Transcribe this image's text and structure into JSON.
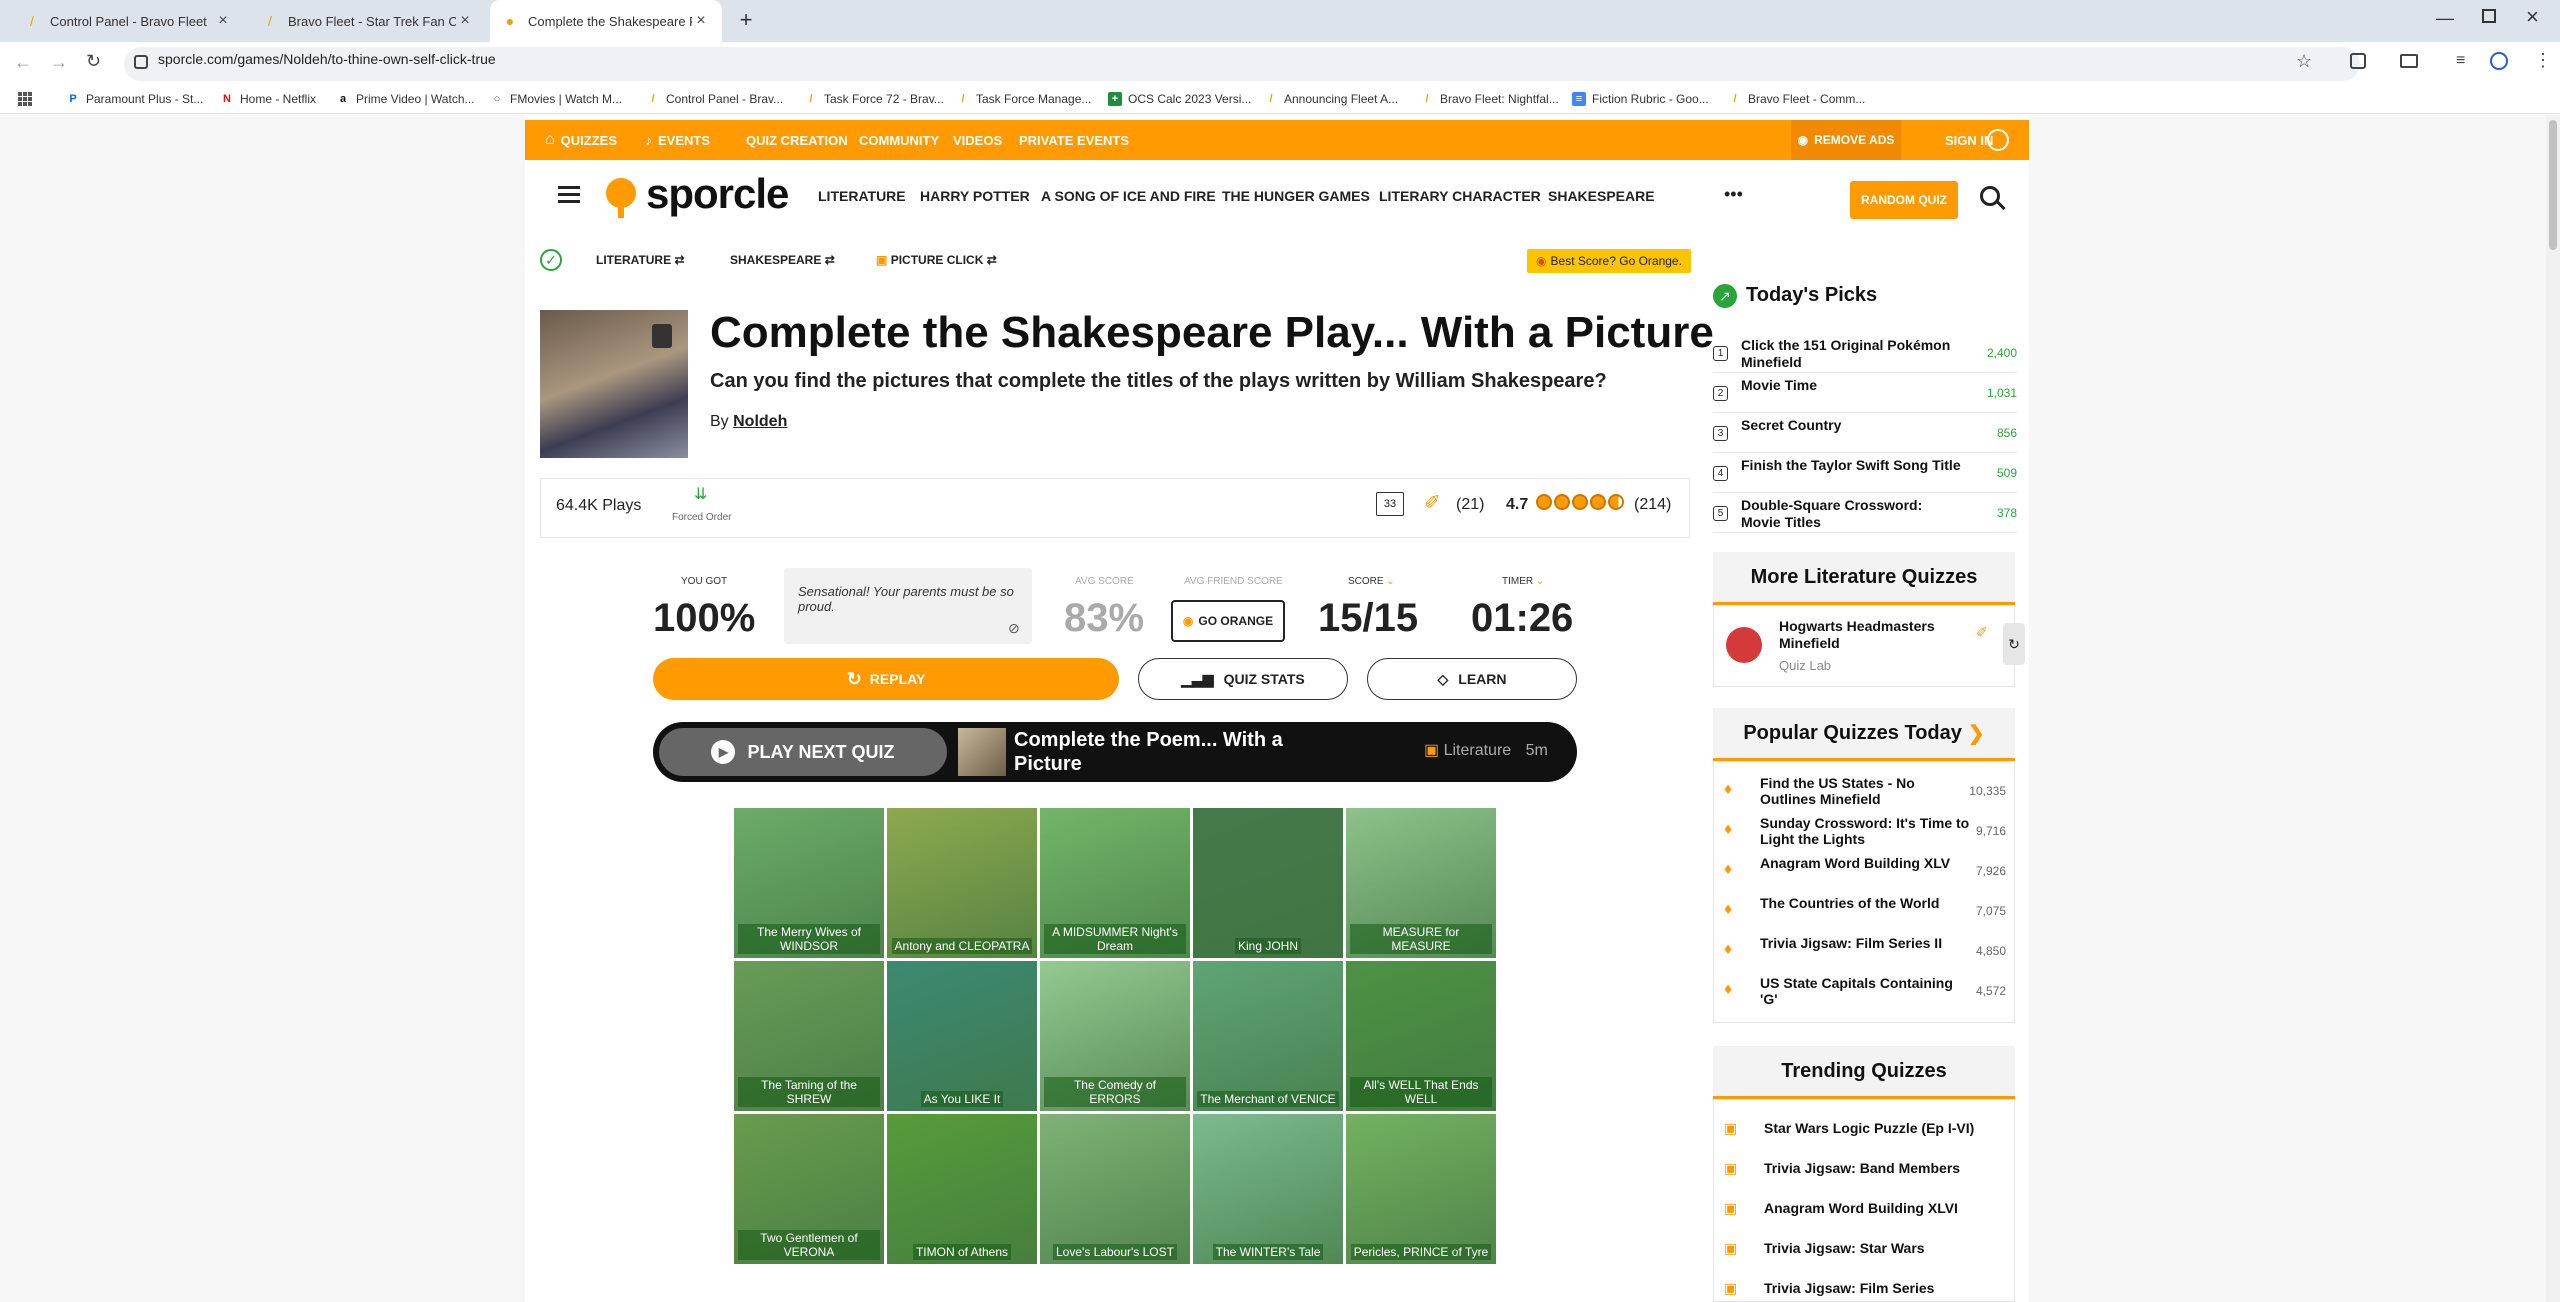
{
  "browser": {
    "tabs": [
      {
        "title": "Control Panel - Bravo Fleet",
        "active": false
      },
      {
        "title": "Bravo Fleet - Star Trek Fan Com",
        "active": false
      },
      {
        "title": "Complete the Shakespeare Play",
        "active": true
      }
    ],
    "new_tab": "+",
    "url": "sporcle.com/games/Noldeh/to-thine-own-self-click-true",
    "bookmarks": [
      {
        "label": "Paramount Plus - St...",
        "icon": "P"
      },
      {
        "label": "Home - Netflix",
        "icon": "N"
      },
      {
        "label": "Prime Video | Watch...",
        "icon": "a"
      },
      {
        "label": "FMovies | Watch M...",
        "icon": "○"
      },
      {
        "label": "Control Panel - Brav...",
        "icon": "/"
      },
      {
        "label": "Task Force 72 - Brav...",
        "icon": "/"
      },
      {
        "label": "Task Force Manage...",
        "icon": "/"
      },
      {
        "label": "OCS Calc 2023 Versi...",
        "icon": "+"
      },
      {
        "label": "Announcing Fleet A...",
        "icon": "/"
      },
      {
        "label": "Bravo Fleet: Nightfal...",
        "icon": "/"
      },
      {
        "label": "Fiction Rubric - Goo...",
        "icon": "≡"
      },
      {
        "label": "Bravo Fleet - Comm...",
        "icon": "/"
      }
    ]
  },
  "topnav": {
    "items": [
      "QUIZZES",
      "EVENTS",
      "QUIZ CREATION",
      "COMMUNITY",
      "VIDEOS",
      "PRIVATE EVENTS"
    ],
    "remove_ads": "REMOVE ADS",
    "sign_in": "SIGN IN"
  },
  "header": {
    "logo": "sporcle",
    "links": [
      "LITERATURE",
      "HARRY POTTER",
      "A SONG OF ICE AND FIRE",
      "THE HUNGER GAMES",
      "LITERARY CHARACTER",
      "SHAKESPEARE"
    ],
    "more": "•••",
    "random_quiz": "RANDOM QUIZ"
  },
  "breadcrumbs": [
    "LITERATURE",
    "SHAKESPEARE",
    "PICTURE CLICK"
  ],
  "best_score": "Best Score? Go Orange.",
  "quiz": {
    "title": "Complete the Shakespeare Play... With a Picture",
    "subtitle": "Can you find the pictures that complete the titles of the plays written by William Shakespeare?",
    "by": "By",
    "author": "Noldeh",
    "plays": "64.4K Plays",
    "order": "Forced Order",
    "comments": "33",
    "favorites": "(21)",
    "rating": "4.7",
    "rating_count": "(214)",
    "rating_value": 4.7
  },
  "score": {
    "you_got_label": "YOU GOT",
    "you_got": "100%",
    "message": "Sensational! Your parents must be so proud.",
    "avg_label": "AVG SCORE",
    "avg": "83%",
    "friend_label": "AVG FRIEND SCORE",
    "go_orange": "GO ORANGE",
    "score_label": "SCORE",
    "score": "15/15",
    "timer_label": "TIMER",
    "timer": "01:26"
  },
  "actions": {
    "replay": "REPLAY",
    "quiz_stats": "QUIZ STATS",
    "learn": "LEARN"
  },
  "next_quiz": {
    "button": "PLAY NEXT QUIZ",
    "title": "Complete the Poem... With a Picture",
    "category": "Literature",
    "time": "5m"
  },
  "grid": [
    {
      "label": "The Merry Wives of WINDSOR",
      "color": "#8fa58a"
    },
    {
      "label": "Antony and CLEOPATRA",
      "color": "#c9a15a"
    },
    {
      "label": "A MIDSUMMER Night's Dream",
      "color": "#9bb68a"
    },
    {
      "label": "King JOHN",
      "color": "#4b4f57"
    },
    {
      "label": "MEASURE for MEASURE",
      "color": "#c8ccc4"
    },
    {
      "label": "The Taming of the SHREW",
      "color": "#8a8a6a"
    },
    {
      "label": "As You LIKE It",
      "color": "#3d6a9a"
    },
    {
      "label": "The Comedy of ERRORS",
      "color": "#d6d8d0"
    },
    {
      "label": "The Merchant of VENICE",
      "color": "#7a9aa0"
    },
    {
      "label": "All's WELL That Ends WELL",
      "color": "#5a7a4a"
    },
    {
      "label": "Two Gentlemen of VERONA",
      "color": "#8a8a5a"
    },
    {
      "label": "TIMON of Athens",
      "color": "#6a8a3a"
    },
    {
      "label": "Love's Labour's LOST",
      "color": "#b0b0a0"
    },
    {
      "label": "The WINTER's Tale",
      "color": "#a8c0c8"
    },
    {
      "label": "Pericles, PRINCE of Tyre",
      "color": "#9ab07a"
    }
  ],
  "todays_picks": {
    "title": "Today's Picks",
    "items": [
      {
        "n": "1",
        "title": "Click the 151 Original Pokémon Minefield",
        "value": "2,400"
      },
      {
        "n": "2",
        "title": "Movie Time",
        "value": "1,031"
      },
      {
        "n": "3",
        "title": "Secret Country",
        "value": "856"
      },
      {
        "n": "4",
        "title": "Finish the Taylor Swift Song Title",
        "value": "509"
      },
      {
        "n": "5",
        "title": "Double-Square Crossword: Movie Titles",
        "value": "378"
      }
    ]
  },
  "more_literature": {
    "title": "More Literature Quizzes",
    "item_title": "Hogwarts Headmasters Minefield",
    "item_sub": "Quiz Lab"
  },
  "popular": {
    "title": "Popular Quizzes Today",
    "items": [
      {
        "title": "Find the US States - No Outlines Minefield",
        "value": "10,335"
      },
      {
        "title": "Sunday Crossword: It's Time to Light the Lights",
        "value": "9,716"
      },
      {
        "title": "Anagram Word Building XLV",
        "value": "7,926"
      },
      {
        "title": "The Countries of the World",
        "value": "7,075"
      },
      {
        "title": "Trivia Jigsaw: Film Series II",
        "value": "4,850"
      },
      {
        "title": "US State Capitals Containing 'G'",
        "value": "4,572"
      }
    ]
  },
  "trending": {
    "title": "Trending Quizzes",
    "items": [
      {
        "title": "Star Wars Logic Puzzle (Ep I-VI)"
      },
      {
        "title": "Trivia Jigsaw: Band Members"
      },
      {
        "title": "Anagram Word Building XLVI"
      },
      {
        "title": "Trivia Jigsaw: Star Wars"
      },
      {
        "title": "Trivia Jigsaw: Film Series"
      }
    ]
  },
  "colors": {
    "brand_orange": "#ff9a00",
    "green": "#2aa53a",
    "grid_overlay": "rgba(60,180,60,0.42)"
  }
}
